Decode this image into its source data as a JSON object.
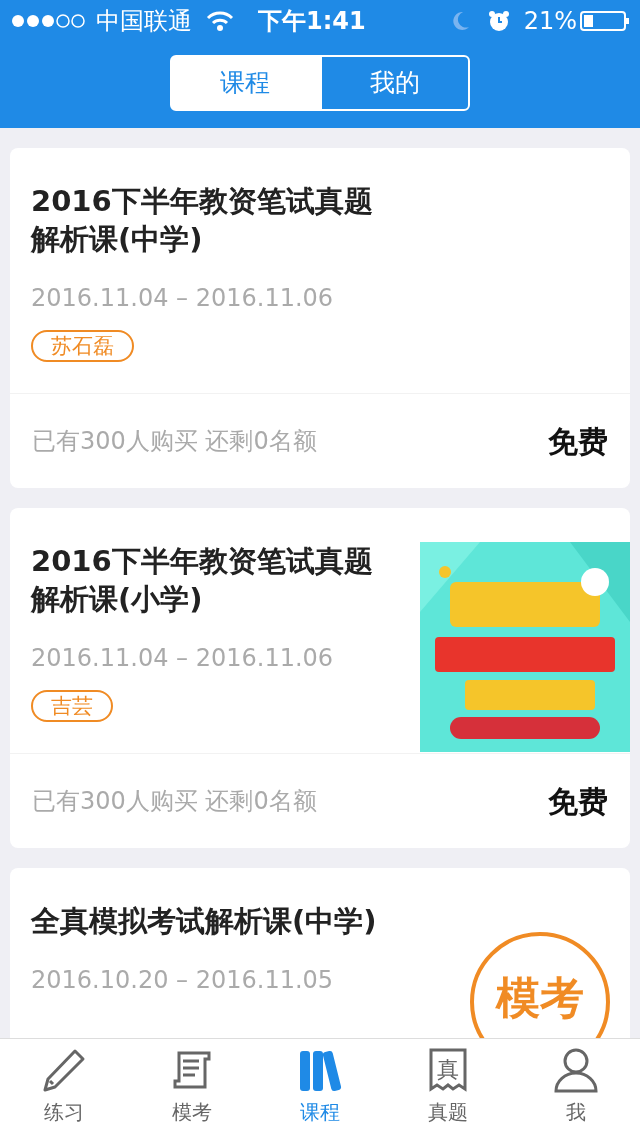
{
  "status_bar": {
    "carrier": "中国联通",
    "time": "下午1:41",
    "battery": "21%"
  },
  "segments": [
    {
      "label": "课程",
      "selected": true
    },
    {
      "label": "我的",
      "selected": false
    }
  ],
  "courses": [
    {
      "title": "2016下半年教资笔试真题解析课(中学)",
      "dates": "2016.11.04 – 2016.11.06",
      "teacher": "苏石磊",
      "sales": "已有300人购买 还剩0名额",
      "price": "免费"
    },
    {
      "title": "2016下半年教资笔试真题解析课(小学)",
      "dates": "2016.11.04 – 2016.11.06",
      "teacher": "吉芸",
      "sales": "已有300人购买 还剩0名额",
      "price": "免费"
    },
    {
      "title": "全真模拟考试解析课(中学)",
      "dates": "2016.10.20 – 2016.11.05",
      "stamp": "模考"
    }
  ],
  "tabs": [
    {
      "label": "练习",
      "selected": false
    },
    {
      "label": "模考",
      "selected": false
    },
    {
      "label": "课程",
      "selected": true
    },
    {
      "label": "真题",
      "selected": false,
      "icon_text": "真"
    },
    {
      "label": "我",
      "selected": false
    }
  ]
}
